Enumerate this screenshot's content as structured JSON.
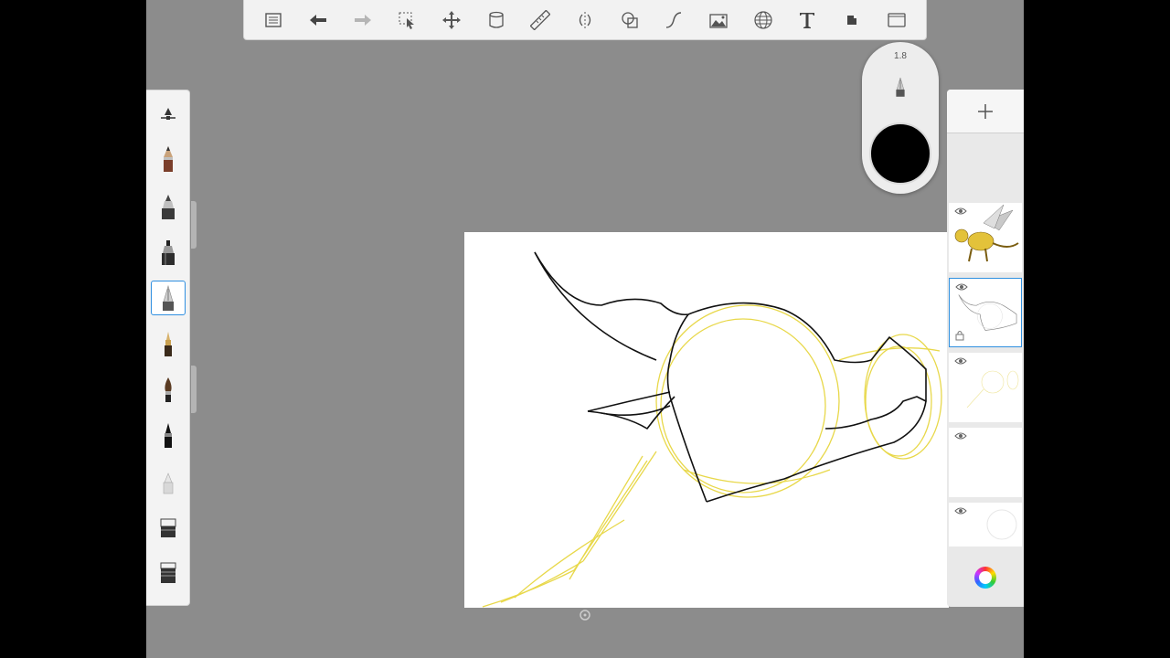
{
  "toolbar": {
    "tools": [
      {
        "name": "gallery-icon"
      },
      {
        "name": "undo-icon"
      },
      {
        "name": "redo-icon"
      },
      {
        "name": "selection-icon"
      },
      {
        "name": "transform-icon"
      },
      {
        "name": "fill-icon"
      },
      {
        "name": "ruler-icon"
      },
      {
        "name": "symmetry-icon"
      },
      {
        "name": "shape-icon"
      },
      {
        "name": "curve-icon"
      },
      {
        "name": "image-icon"
      },
      {
        "name": "perspective-icon"
      },
      {
        "name": "text-icon"
      },
      {
        "name": "layer-editor-icon"
      },
      {
        "name": "fullscreen-icon"
      }
    ]
  },
  "brush_palette": {
    "items": [
      "brush-settings-icon",
      "pencil-icon",
      "ballpoint-icon",
      "marker-icon",
      "airbrush-icon",
      "fineliner-icon",
      "paintbrush-icon",
      "ink-pen-icon",
      "smudge-icon",
      "eraser-icon",
      "hard-eraser-icon"
    ],
    "selected_index": 4
  },
  "puck": {
    "brush_size": "1.8",
    "current_color": "#000000"
  },
  "layers": {
    "items": [
      {
        "name": "reference-layer",
        "visible": true
      },
      {
        "name": "lineart-layer",
        "visible": true,
        "selected": true
      },
      {
        "name": "sketch-layer",
        "visible": true
      },
      {
        "name": "empty-layer",
        "visible": true
      },
      {
        "name": "background-layer",
        "visible": true
      }
    ]
  },
  "colors": {
    "accent": "#2f8fe0",
    "sketch": "#e8d84a",
    "ink": "#111111"
  }
}
